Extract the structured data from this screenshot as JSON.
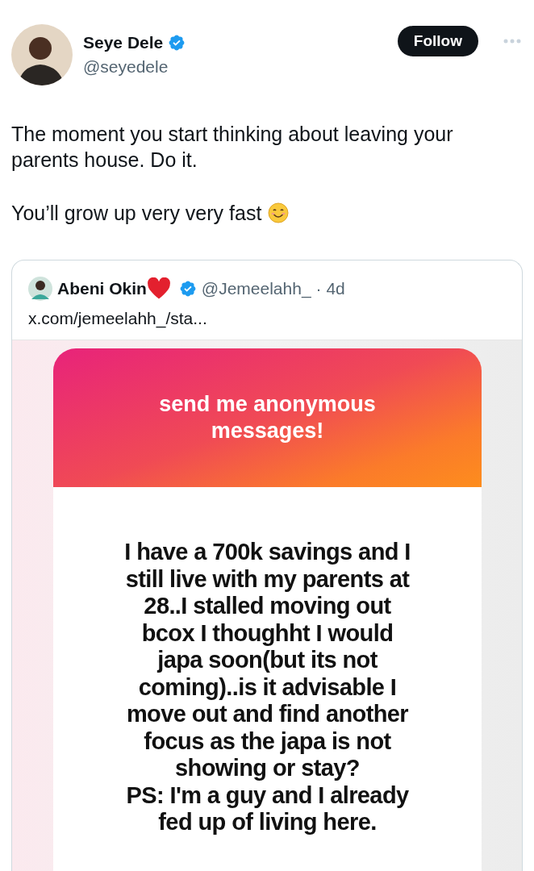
{
  "author": {
    "name": "Seye Dele",
    "handle": "@seyedele",
    "verified": true
  },
  "follow_button": {
    "label": "Follow"
  },
  "tweet_text": [
    "The moment you start thinking about leaving your parents house. Do it.",
    "You’ll grow up very very fast"
  ],
  "quoted_tweet": {
    "name": "Abeni Okin",
    "verified": true,
    "handle": "@Jemeelahh_",
    "time": "· 4d",
    "link": "x.com/jemeelahh_/sta...",
    "card": {
      "header": "send me anonymous messages!",
      "message_lines": [
        "I have a 700k savings and I",
        "still live with my parents at",
        "28..I stalled moving out",
        "bcox I thoughht I would",
        "japa soon(but its not",
        "coming)..is it advisable I",
        "move out and find another",
        "focus as the japa is not",
        "showing or stay?",
        "PS: I'm a guy and I already",
        "fed up of living here."
      ]
    }
  }
}
